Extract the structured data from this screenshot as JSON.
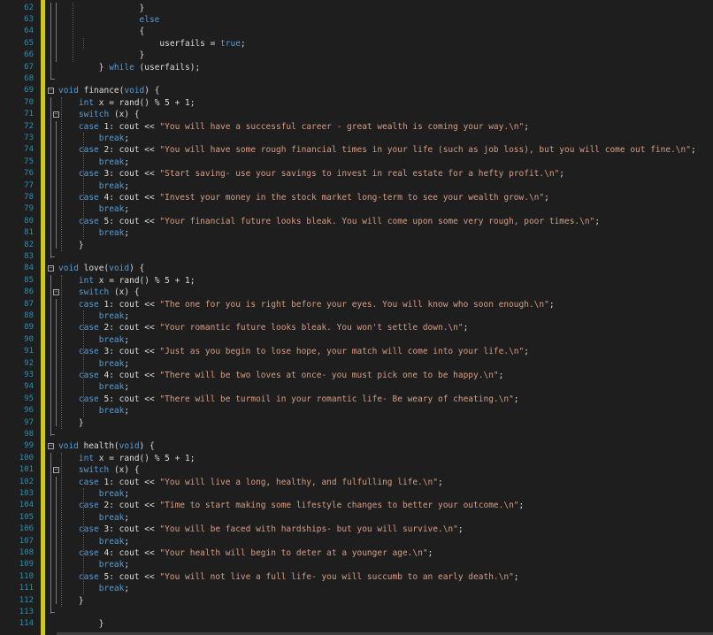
{
  "editor": {
    "lines": [
      {
        "num": "62",
        "segs": [
          {
            "t": "                }",
            "c": "p"
          }
        ]
      },
      {
        "num": "63",
        "segs": [
          {
            "t": "                ",
            "c": "p"
          },
          {
            "t": "else",
            "c": "kw"
          }
        ]
      },
      {
        "num": "64",
        "segs": [
          {
            "t": "                {",
            "c": "p"
          }
        ]
      },
      {
        "num": "65",
        "segs": [
          {
            "t": "                    userfails = ",
            "c": "p"
          },
          {
            "t": "true",
            "c": "kw"
          },
          {
            "t": ";",
            "c": "p"
          }
        ]
      },
      {
        "num": "66",
        "segs": [
          {
            "t": "                }",
            "c": "p"
          }
        ]
      },
      {
        "num": "67",
        "segs": [
          {
            "t": "        } ",
            "c": "p"
          },
          {
            "t": "while",
            "c": "kw"
          },
          {
            "t": " (userfails);",
            "c": "p"
          }
        ]
      },
      {
        "num": "68",
        "segs": [
          {
            "t": "",
            "c": "p"
          }
        ]
      },
      {
        "num": "69",
        "segs": [
          {
            "t": "void",
            "c": "kw"
          },
          {
            "t": " finance(",
            "c": "p"
          },
          {
            "t": "void",
            "c": "kw"
          },
          {
            "t": ") {",
            "c": "p"
          }
        ]
      },
      {
        "num": "70",
        "segs": [
          {
            "t": "    ",
            "c": "p"
          },
          {
            "t": "int",
            "c": "kw"
          },
          {
            "t": " x = rand() % 5 + 1;",
            "c": "p"
          }
        ]
      },
      {
        "num": "71",
        "segs": [
          {
            "t": "    ",
            "c": "p"
          },
          {
            "t": "switch",
            "c": "kw"
          },
          {
            "t": " (x) {",
            "c": "p"
          }
        ]
      },
      {
        "num": "72",
        "segs": [
          {
            "t": "    ",
            "c": "p"
          },
          {
            "t": "case",
            "c": "kw"
          },
          {
            "t": " 1: cout << ",
            "c": "p"
          },
          {
            "t": "\"You will have a successful career - great wealth is coming your way.\\n\"",
            "c": "str"
          },
          {
            "t": ";",
            "c": "p"
          }
        ]
      },
      {
        "num": "73",
        "segs": [
          {
            "t": "        ",
            "c": "p"
          },
          {
            "t": "break",
            "c": "kw"
          },
          {
            "t": ";",
            "c": "p"
          }
        ]
      },
      {
        "num": "74",
        "segs": [
          {
            "t": "    ",
            "c": "p"
          },
          {
            "t": "case",
            "c": "kw"
          },
          {
            "t": " 2: cout << ",
            "c": "p"
          },
          {
            "t": "\"You will have some rough financial times in your life (such as job loss), but you will come out fine.\\n\"",
            "c": "str"
          },
          {
            "t": ";",
            "c": "p"
          }
        ]
      },
      {
        "num": "75",
        "segs": [
          {
            "t": "        ",
            "c": "p"
          },
          {
            "t": "break",
            "c": "kw"
          },
          {
            "t": ";",
            "c": "p"
          }
        ]
      },
      {
        "num": "76",
        "segs": [
          {
            "t": "    ",
            "c": "p"
          },
          {
            "t": "case",
            "c": "kw"
          },
          {
            "t": " 3: cout << ",
            "c": "p"
          },
          {
            "t": "\"Start saving- use your savings to invest in real estate for a hefty profit.\\n\"",
            "c": "str"
          },
          {
            "t": ";",
            "c": "p"
          }
        ]
      },
      {
        "num": "77",
        "segs": [
          {
            "t": "        ",
            "c": "p"
          },
          {
            "t": "break",
            "c": "kw"
          },
          {
            "t": ";",
            "c": "p"
          }
        ]
      },
      {
        "num": "78",
        "segs": [
          {
            "t": "    ",
            "c": "p"
          },
          {
            "t": "case",
            "c": "kw"
          },
          {
            "t": " 4: cout << ",
            "c": "p"
          },
          {
            "t": "\"Invest your money in the stock market long-term to see your wealth grow.\\n\"",
            "c": "str"
          },
          {
            "t": ";",
            "c": "p"
          }
        ]
      },
      {
        "num": "79",
        "segs": [
          {
            "t": "        ",
            "c": "p"
          },
          {
            "t": "break",
            "c": "kw"
          },
          {
            "t": ";",
            "c": "p"
          }
        ]
      },
      {
        "num": "80",
        "segs": [
          {
            "t": "    ",
            "c": "p"
          },
          {
            "t": "case",
            "c": "kw"
          },
          {
            "t": " 5: cout << ",
            "c": "p"
          },
          {
            "t": "\"Your financial future looks bleak. You will come upon some very rough, poor times.\\n\"",
            "c": "str"
          },
          {
            "t": ";",
            "c": "p"
          }
        ]
      },
      {
        "num": "81",
        "segs": [
          {
            "t": "        ",
            "c": "p"
          },
          {
            "t": "break",
            "c": "kw"
          },
          {
            "t": ";",
            "c": "p"
          }
        ]
      },
      {
        "num": "82",
        "segs": [
          {
            "t": "    }",
            "c": "p"
          }
        ]
      },
      {
        "num": "83",
        "segs": [
          {
            "t": "",
            "c": "p"
          }
        ]
      },
      {
        "num": "84",
        "segs": [
          {
            "t": "void",
            "c": "kw"
          },
          {
            "t": " love(",
            "c": "p"
          },
          {
            "t": "void",
            "c": "kw"
          },
          {
            "t": ") {",
            "c": "p"
          }
        ]
      },
      {
        "num": "85",
        "segs": [
          {
            "t": "    ",
            "c": "p"
          },
          {
            "t": "int",
            "c": "kw"
          },
          {
            "t": " x = rand() % 5 + 1;",
            "c": "p"
          }
        ]
      },
      {
        "num": "86",
        "segs": [
          {
            "t": "    ",
            "c": "p"
          },
          {
            "t": "switch",
            "c": "kw"
          },
          {
            "t": " (x) {",
            "c": "p"
          }
        ]
      },
      {
        "num": "87",
        "segs": [
          {
            "t": "    ",
            "c": "p"
          },
          {
            "t": "case",
            "c": "kw"
          },
          {
            "t": " 1: cout << ",
            "c": "p"
          },
          {
            "t": "\"The one for you is right before your eyes. You will know who soon enough.\\n\"",
            "c": "str"
          },
          {
            "t": ";",
            "c": "p"
          }
        ]
      },
      {
        "num": "88",
        "segs": [
          {
            "t": "        ",
            "c": "p"
          },
          {
            "t": "break",
            "c": "kw"
          },
          {
            "t": ";",
            "c": "p"
          }
        ]
      },
      {
        "num": "89",
        "segs": [
          {
            "t": "    ",
            "c": "p"
          },
          {
            "t": "case",
            "c": "kw"
          },
          {
            "t": " 2: cout << ",
            "c": "p"
          },
          {
            "t": "\"Your romantic future looks bleak. You won't settle down.\\n\"",
            "c": "str"
          },
          {
            "t": ";",
            "c": "p"
          }
        ]
      },
      {
        "num": "90",
        "segs": [
          {
            "t": "        ",
            "c": "p"
          },
          {
            "t": "break",
            "c": "kw"
          },
          {
            "t": ";",
            "c": "p"
          }
        ]
      },
      {
        "num": "91",
        "segs": [
          {
            "t": "    ",
            "c": "p"
          },
          {
            "t": "case",
            "c": "kw"
          },
          {
            "t": " 3: cout << ",
            "c": "p"
          },
          {
            "t": "\"Just as you begin to lose hope, your match will come into your life.\\n\"",
            "c": "str"
          },
          {
            "t": ";",
            "c": "p"
          }
        ]
      },
      {
        "num": "92",
        "segs": [
          {
            "t": "        ",
            "c": "p"
          },
          {
            "t": "break",
            "c": "kw"
          },
          {
            "t": ";",
            "c": "p"
          }
        ]
      },
      {
        "num": "93",
        "segs": [
          {
            "t": "    ",
            "c": "p"
          },
          {
            "t": "case",
            "c": "kw"
          },
          {
            "t": " 4: cout << ",
            "c": "p"
          },
          {
            "t": "\"There will be two loves at once- you must pick one to be happy.\\n\"",
            "c": "str"
          },
          {
            "t": ";",
            "c": "p"
          }
        ]
      },
      {
        "num": "94",
        "segs": [
          {
            "t": "        ",
            "c": "p"
          },
          {
            "t": "break",
            "c": "kw"
          },
          {
            "t": ";",
            "c": "p"
          }
        ]
      },
      {
        "num": "95",
        "segs": [
          {
            "t": "    ",
            "c": "p"
          },
          {
            "t": "case",
            "c": "kw"
          },
          {
            "t": " 5: cout << ",
            "c": "p"
          },
          {
            "t": "\"There will be turmoil in your romantic life- Be weary of cheating.\\n\"",
            "c": "str"
          },
          {
            "t": ";",
            "c": "p"
          }
        ]
      },
      {
        "num": "96",
        "segs": [
          {
            "t": "        ",
            "c": "p"
          },
          {
            "t": "break",
            "c": "kw"
          },
          {
            "t": ";",
            "c": "p"
          }
        ]
      },
      {
        "num": "97",
        "segs": [
          {
            "t": "    }",
            "c": "p"
          }
        ]
      },
      {
        "num": "98",
        "segs": [
          {
            "t": "",
            "c": "p"
          }
        ]
      },
      {
        "num": "99",
        "segs": [
          {
            "t": "void",
            "c": "kw"
          },
          {
            "t": " health(",
            "c": "p"
          },
          {
            "t": "void",
            "c": "kw"
          },
          {
            "t": ") {",
            "c": "p"
          }
        ]
      },
      {
        "num": "100",
        "segs": [
          {
            "t": "    ",
            "c": "p"
          },
          {
            "t": "int",
            "c": "kw"
          },
          {
            "t": " x = rand() % 5 + 1;",
            "c": "p"
          }
        ]
      },
      {
        "num": "101",
        "segs": [
          {
            "t": "    ",
            "c": "p"
          },
          {
            "t": "switch",
            "c": "kw"
          },
          {
            "t": " (x) {",
            "c": "p"
          }
        ]
      },
      {
        "num": "102",
        "segs": [
          {
            "t": "    ",
            "c": "p"
          },
          {
            "t": "case",
            "c": "kw"
          },
          {
            "t": " 1: cout << ",
            "c": "p"
          },
          {
            "t": "\"You will live a long, healthy, and fulfulling life.\\n\"",
            "c": "str"
          },
          {
            "t": ";",
            "c": "p"
          }
        ]
      },
      {
        "num": "103",
        "segs": [
          {
            "t": "        ",
            "c": "p"
          },
          {
            "t": "break",
            "c": "kw"
          },
          {
            "t": ";",
            "c": "p"
          }
        ]
      },
      {
        "num": "104",
        "segs": [
          {
            "t": "    ",
            "c": "p"
          },
          {
            "t": "case",
            "c": "kw"
          },
          {
            "t": " 2: cout << ",
            "c": "p"
          },
          {
            "t": "\"Time to start making some lifestyle changes to better your outcome.\\n\"",
            "c": "str"
          },
          {
            "t": ";",
            "c": "p"
          }
        ]
      },
      {
        "num": "105",
        "segs": [
          {
            "t": "        ",
            "c": "p"
          },
          {
            "t": "break",
            "c": "kw"
          },
          {
            "t": ";",
            "c": "p"
          }
        ]
      },
      {
        "num": "106",
        "segs": [
          {
            "t": "    ",
            "c": "p"
          },
          {
            "t": "case",
            "c": "kw"
          },
          {
            "t": " 3: cout << ",
            "c": "p"
          },
          {
            "t": "\"You will be faced with hardships- but you will survive.\\n\"",
            "c": "str"
          },
          {
            "t": ";",
            "c": "p"
          }
        ]
      },
      {
        "num": "107",
        "segs": [
          {
            "t": "        ",
            "c": "p"
          },
          {
            "t": "break",
            "c": "kw"
          },
          {
            "t": ";",
            "c": "p"
          }
        ]
      },
      {
        "num": "108",
        "segs": [
          {
            "t": "    ",
            "c": "p"
          },
          {
            "t": "case",
            "c": "kw"
          },
          {
            "t": " 4: cout << ",
            "c": "p"
          },
          {
            "t": "\"Your health will begin to deter at a younger age.\\n\"",
            "c": "str"
          },
          {
            "t": ";",
            "c": "p"
          }
        ]
      },
      {
        "num": "109",
        "segs": [
          {
            "t": "        ",
            "c": "p"
          },
          {
            "t": "break",
            "c": "kw"
          },
          {
            "t": ";",
            "c": "p"
          }
        ]
      },
      {
        "num": "110",
        "segs": [
          {
            "t": "    ",
            "c": "p"
          },
          {
            "t": "case",
            "c": "kw"
          },
          {
            "t": " 5: cout << ",
            "c": "p"
          },
          {
            "t": "\"You will not live a full life- you will succumb to an early death.\\n\"",
            "c": "str"
          },
          {
            "t": ";",
            "c": "p"
          }
        ]
      },
      {
        "num": "111",
        "segs": [
          {
            "t": "        ",
            "c": "p"
          },
          {
            "t": "break",
            "c": "kw"
          },
          {
            "t": ";",
            "c": "p"
          }
        ]
      },
      {
        "num": "112",
        "segs": [
          {
            "t": "    }",
            "c": "p"
          }
        ]
      },
      {
        "num": "113",
        "segs": [
          {
            "t": "",
            "c": "p"
          }
        ]
      },
      {
        "num": "114",
        "segs": [
          {
            "t": "        }",
            "c": "p"
          }
        ]
      }
    ]
  },
  "colors": {
    "background": "#1e1e1e",
    "keyword": "#569cd6",
    "string": "#d69d85",
    "plain": "#dcdcdc",
    "line_number": "#2b91af",
    "change_bar": "#c9c920"
  },
  "icons": {
    "fold_toggle": "collapse-icon"
  }
}
